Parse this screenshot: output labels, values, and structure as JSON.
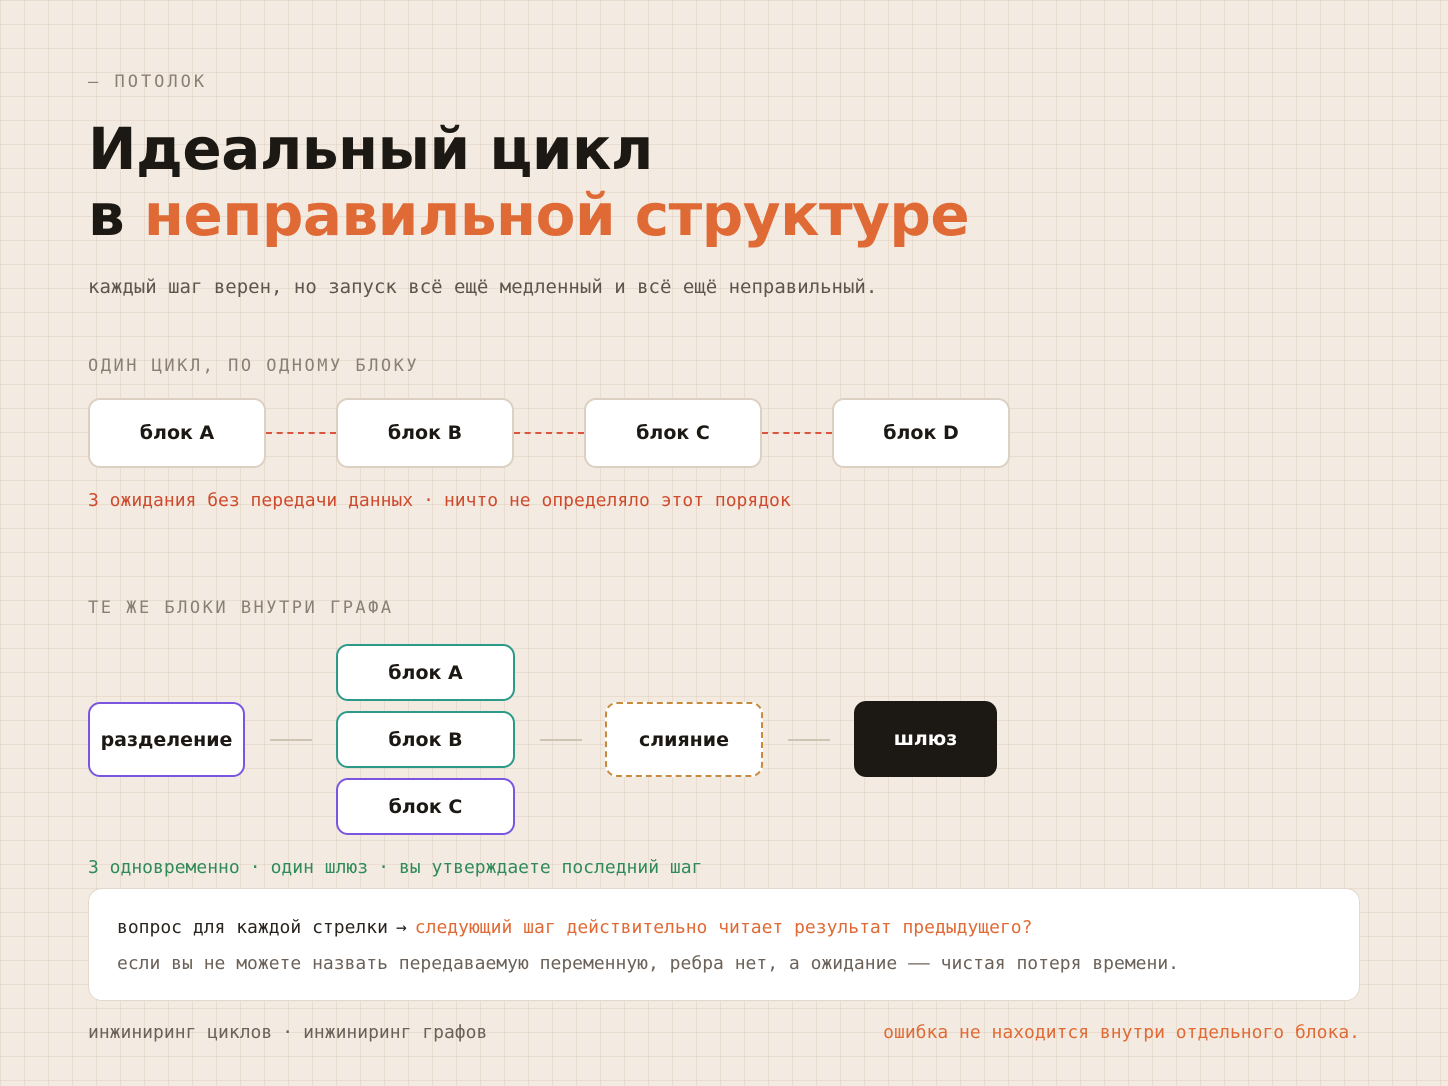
{
  "eyebrow": "— ПОТОЛОК",
  "title": {
    "line1": "Идеальный цикл",
    "line2_prefix": "в",
    "line2_accent": "неправильной структуре"
  },
  "subtitle": "каждый шаг верен, но запуск всё ещё медленный и всё ещё неправильный.",
  "sequence": {
    "label": "ОДИН ЦИКЛ, ПО ОДНОМУ БЛОКУ",
    "blocks": [
      "блок A",
      "блок B",
      "блок C",
      "блок D"
    ],
    "note": {
      "left": "3 ожидания без передачи данных",
      "sep": "·",
      "right": "ничто не определяло этот порядок"
    }
  },
  "graph": {
    "label": "ТЕ ЖЕ БЛОКИ ВНУТРИ ГРАФА",
    "split": "разделение",
    "parallel": [
      "блок A",
      "блок B",
      "блок C"
    ],
    "merge": "слияние",
    "gate": "шлюз",
    "note": {
      "part1": "3 одновременно",
      "sep1": "·",
      "part2": "один шлюз",
      "sep2": "·",
      "part3": "вы утверждаете последний шаг"
    }
  },
  "callout": {
    "question_prefix": "вопрос для каждой стрелки",
    "arrow": "→",
    "question_accent": "следующий шаг действительно читает результат предыдущего?",
    "answer": "если вы не можете назвать передаваемую переменную, ребра нет, а ожидание —— чистая потеря времени."
  },
  "footer": {
    "left_a": "инжиниринг циклов",
    "sep": "·",
    "left_b": "инжиниринг графов",
    "right": "ошибка не находится внутри отдельного блока."
  },
  "colors": {
    "background": "#f3ebe1",
    "accent": "#e06a35",
    "warning": "#cf4a2c",
    "success": "#2f8a5a",
    "split_border": "#7a56e0",
    "teal_border": "#2c9a88",
    "merge_border": "#c98a3c",
    "gate_fill": "#1c1814"
  }
}
